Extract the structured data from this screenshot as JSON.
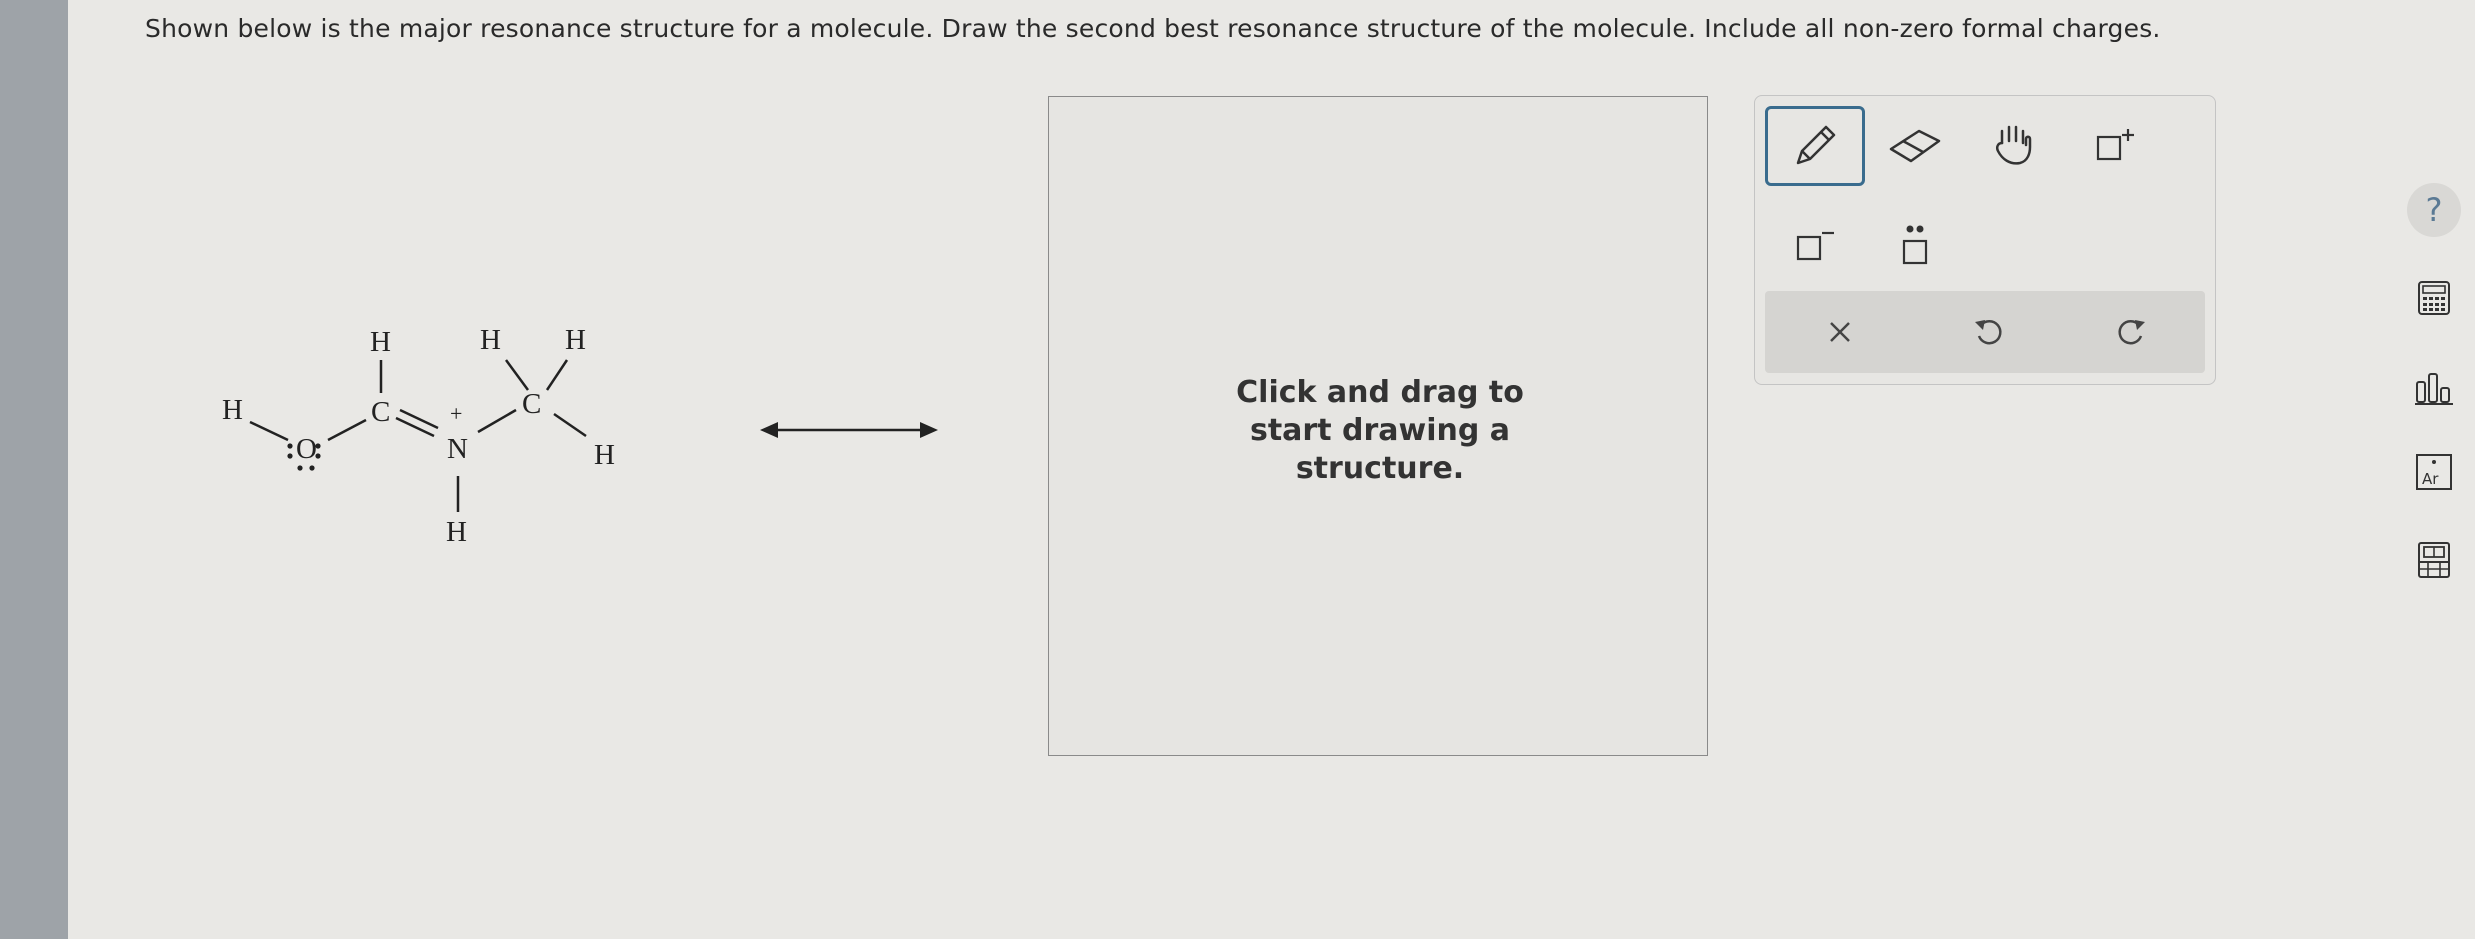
{
  "question": {
    "text": "Shown below is the major resonance structure for a molecule. Draw the second best resonance structure of the molecule. Include all non-zero formal charges."
  },
  "molecule": {
    "atoms": {
      "h_left": "H",
      "o": "O",
      "h_top_c1": "H",
      "c1": "C",
      "n": "N",
      "n_charge": "+",
      "h_n": "H",
      "c2": "C",
      "h_c2_a": "H",
      "h_c2_b": "H",
      "h_c2_c": "H"
    }
  },
  "drawing_area": {
    "prompt_line1": "Click and drag to",
    "prompt_line2": "start drawing a",
    "prompt_line3": "structure."
  },
  "toolbar": {
    "tools": [
      "pencil-tool",
      "eraser-tool",
      "move-hand-tool",
      "positive-charge-tool",
      "negative-charge-tool",
      "lone-pair-tool"
    ],
    "actions": [
      "clear",
      "undo",
      "redo"
    ]
  },
  "colors": {
    "accent": "#3a6c8e",
    "background": "#e9e8e5",
    "left_strip": "#9ea3a8"
  }
}
